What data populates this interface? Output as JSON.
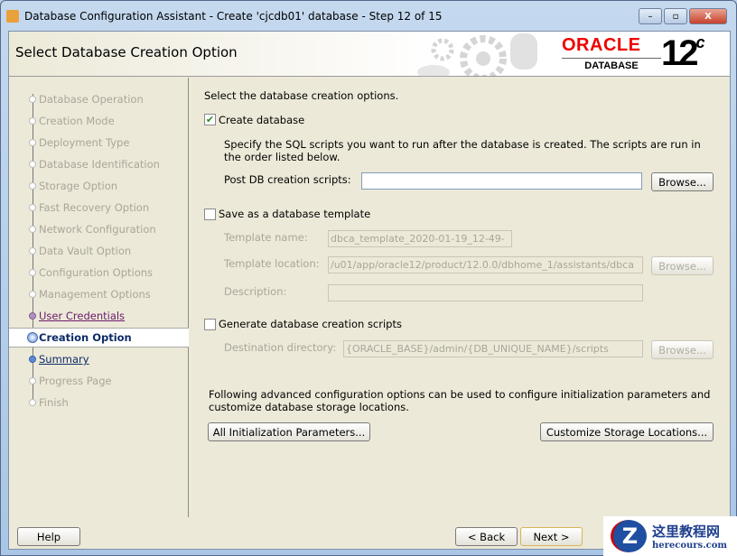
{
  "window": {
    "title": "Database Configuration Assistant - Create 'cjcdb01' database - Step 12 of 15",
    "minimize": "–",
    "maximize": "▫",
    "close": "X"
  },
  "header": {
    "title": "Select Database Creation Option",
    "brand": "ORACLE",
    "brand_sub": "DATABASE",
    "version": "12",
    "version_sup": "c"
  },
  "steps": [
    {
      "label": "Database Operation",
      "state": "disabled"
    },
    {
      "label": "Creation Mode",
      "state": "disabled"
    },
    {
      "label": "Deployment Type",
      "state": "disabled"
    },
    {
      "label": "Database Identification",
      "state": "disabled"
    },
    {
      "label": "Storage Option",
      "state": "disabled"
    },
    {
      "label": "Fast Recovery Option",
      "state": "disabled"
    },
    {
      "label": "Network Configuration",
      "state": "disabled"
    },
    {
      "label": "Data Vault Option",
      "state": "disabled"
    },
    {
      "label": "Configuration Options",
      "state": "disabled"
    },
    {
      "label": "Management Options",
      "state": "disabled"
    },
    {
      "label": "User Credentials",
      "state": "visited"
    },
    {
      "label": "Creation Option",
      "state": "current"
    },
    {
      "label": "Summary",
      "state": "next"
    },
    {
      "label": "Progress Page",
      "state": "disabled"
    },
    {
      "label": "Finish",
      "state": "disabled"
    }
  ],
  "main": {
    "intro": "Select the database creation options.",
    "create_db": {
      "label": "Create database",
      "checked": true,
      "desc1": "Specify the SQL scripts you want to run after the database is created. The scripts are run in",
      "desc2": "the order listed below.",
      "post_label": "Post DB creation scripts:",
      "post_value": "",
      "browse": "Browse..."
    },
    "save_template": {
      "label": "Save as a database template",
      "checked": false,
      "name_label": "Template name:",
      "name_value": "dbca_template_2020-01-19_12-49-",
      "location_label": "Template location:",
      "location_value": "/u01/app/oracle12/product/12.0.0/dbhome_1/assistants/dbca",
      "browse": "Browse...",
      "desc_label": "Description:",
      "desc_value": ""
    },
    "gen_scripts": {
      "label": "Generate database creation scripts",
      "checked": false,
      "dest_label": "Destination directory:",
      "dest_value": "{ORACLE_BASE}/admin/{DB_UNIQUE_NAME}/scripts",
      "browse": "Browse..."
    },
    "advanced1": "Following advanced configuration options can be used to configure initialization parameters and",
    "advanced2": "customize database storage locations.",
    "init_params": "All Initialization Parameters...",
    "storage": "Customize Storage Locations..."
  },
  "footer": {
    "help": "Help",
    "back": "< Back",
    "next": "Next >"
  },
  "watermark": {
    "cn": "这里教程网",
    "en": "herecours.com",
    "logo": "Z"
  }
}
